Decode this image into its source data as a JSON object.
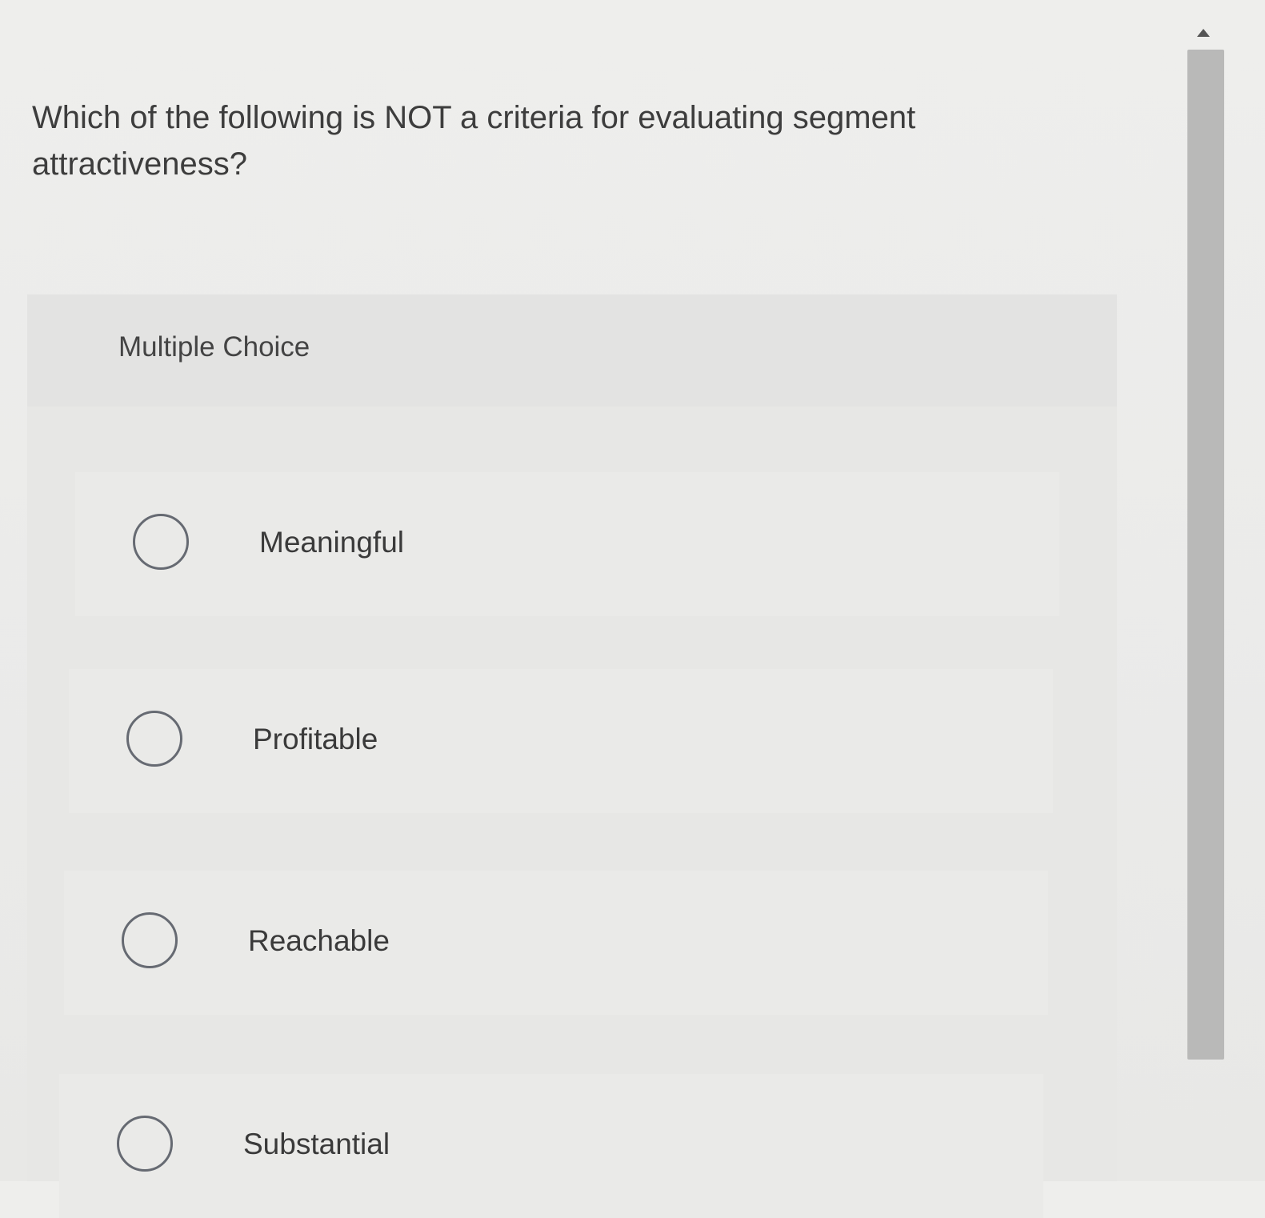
{
  "question": {
    "text": "Which of the following is NOT a criteria for evaluating segment attractiveness?"
  },
  "section": {
    "label": "Multiple Choice"
  },
  "options": [
    {
      "label": "Meaningful",
      "selected": false
    },
    {
      "label": "Profitable",
      "selected": false
    },
    {
      "label": "Reachable",
      "selected": false
    },
    {
      "label": "Substantial",
      "selected": false
    }
  ],
  "scrollbar": {
    "up_arrow_icon": "triangle-up-icon"
  }
}
